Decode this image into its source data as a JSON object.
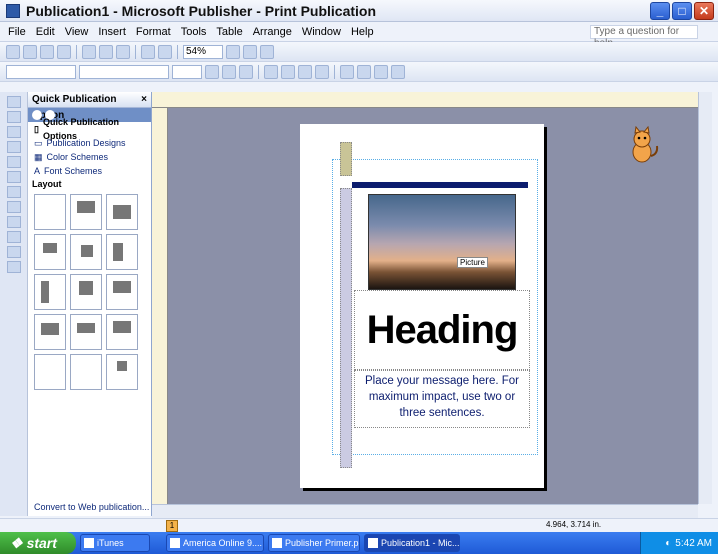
{
  "window": {
    "title": "Publication1 - Microsoft Publisher - Print Publication"
  },
  "menu": [
    "File",
    "Edit",
    "View",
    "Insert",
    "Format",
    "Tools",
    "Table",
    "Arrange",
    "Window",
    "Help"
  ],
  "help_placeholder": "Type a question for help",
  "toolbar": {
    "zoom": "54%"
  },
  "panel": {
    "title": "Quick Publication Option",
    "links": [
      "Quick Publication Options",
      "Publication Designs",
      "Color Schemes",
      "Font Schemes"
    ],
    "layout_label": "Layout",
    "footer_link": "Convert to Web publication..."
  },
  "page": {
    "picture_label": "Picture",
    "heading": "Heading",
    "message": "Place your message here. For maximum impact, use two or three sentences."
  },
  "status": {
    "page_number": "1",
    "coordinates": "4.964, 3.714 in."
  },
  "taskbar": {
    "start": "start",
    "tasks": [
      "iTunes",
      "America Online 9....",
      "Publisher Primer.ppt",
      "Publication1 - Mic..."
    ],
    "clock": "5:42 AM"
  },
  "colors": {
    "navy": "#0c1d6e",
    "taskbar": "#1f5ad6",
    "start": "#2f8b2a"
  }
}
